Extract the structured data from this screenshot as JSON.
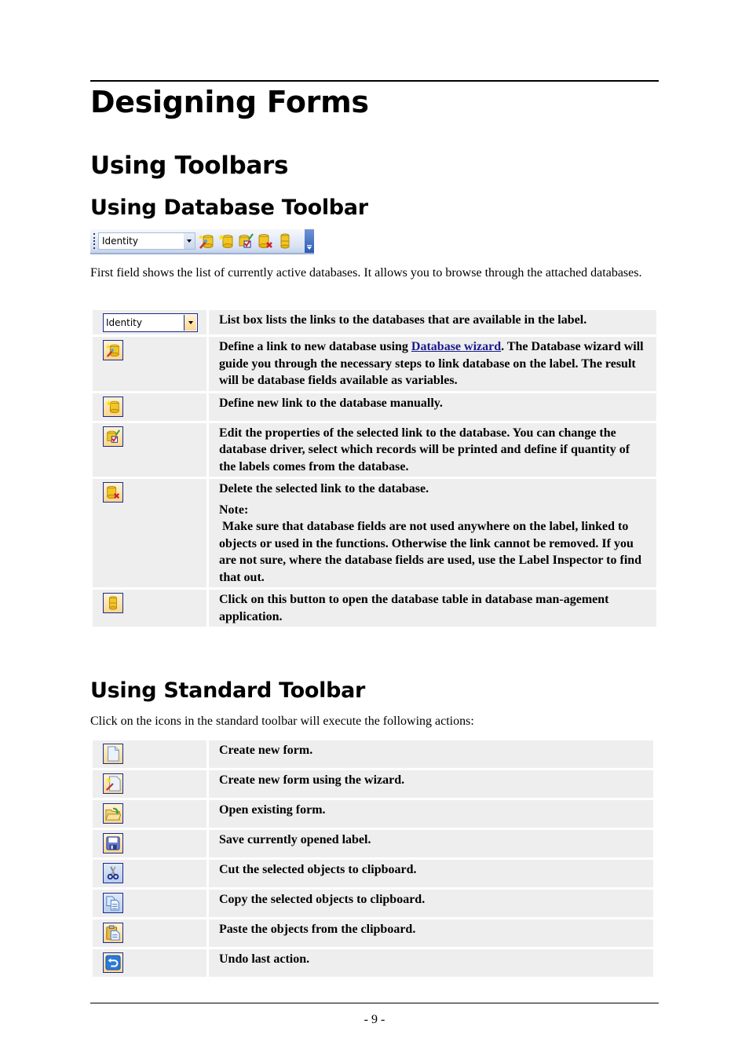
{
  "page": {
    "title": "Designing Forms",
    "section_title": "Using Toolbars",
    "page_number": "- 9 -"
  },
  "database_toolbar": {
    "heading": "Using Database Toolbar",
    "toolbar_combo_value": "Identity",
    "toolbar_icons": [
      "database-wizard-icon",
      "new-database-link-icon",
      "edit-database-link-icon",
      "delete-database-link-icon",
      "open-database-table-icon"
    ],
    "intro": "First field shows the list of currently active databases. It allows you to browse through the attached databases.",
    "rows": [
      {
        "icon": "database-list-combo",
        "combo_value": "Identity",
        "text": "List box lists the links to the databases that are available in the label."
      },
      {
        "icon": "database-wizard-icon",
        "text_before": "Define a link to new database using ",
        "link": "Database wizard",
        "text_after": ". The Database wizard will guide you through the necessary steps to link database on the label. The result will be database fields available as variables."
      },
      {
        "icon": "new-database-link-icon",
        "text": "Define new link to the database manually."
      },
      {
        "icon": "edit-database-link-icon",
        "text": "Edit the properties of the selected link to the database. You can change the database driver, select which records will be printed and define if quantity of the labels comes from the database."
      },
      {
        "icon": "delete-database-link-icon",
        "text": "Delete the selected link to the database.",
        "note_label": "Note:",
        "note": " Make sure that database fields are not used anywhere on the label, linked to objects or used in the functions. Otherwise the link cannot be removed. If you are not sure, where the database fields are used, use the Label Inspector to find that out."
      },
      {
        "icon": "open-database-table-icon",
        "text": "Click on this button to open the database table in database man-agement application."
      }
    ]
  },
  "standard_toolbar": {
    "heading": "Using Standard Toolbar",
    "intro": "Click on the icons in the standard toolbar will execute the following actions:",
    "rows": [
      {
        "icon": "new-form-icon",
        "text": "Create new form."
      },
      {
        "icon": "new-form-wizard-icon",
        "text": "Create new form using the wizard."
      },
      {
        "icon": "open-folder-icon",
        "text": "Open existing form."
      },
      {
        "icon": "save-disk-icon",
        "text": "Save currently opened label."
      },
      {
        "icon": "cut-scissors-icon",
        "text": "Cut the selected objects to clipboard."
      },
      {
        "icon": "copy-icon",
        "text": "Copy the selected objects to clipboard."
      },
      {
        "icon": "paste-clipboard-icon",
        "text": "Paste the objects from the clipboard."
      },
      {
        "icon": "undo-icon",
        "text": "Undo last action."
      }
    ]
  }
}
